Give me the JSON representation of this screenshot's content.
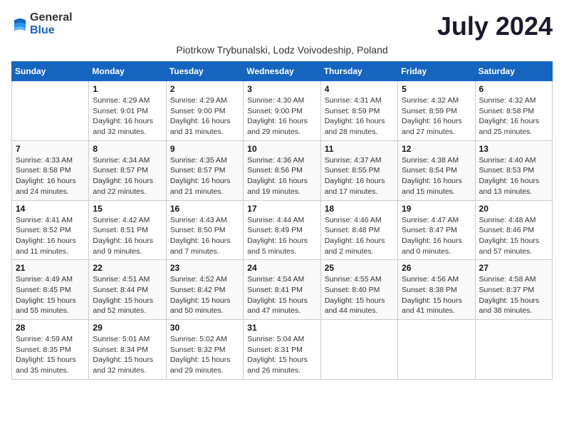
{
  "logo": {
    "general": "General",
    "blue": "Blue"
  },
  "title": "July 2024",
  "subtitle": "Piotrkow Trybunalski, Lodz Voivodeship, Poland",
  "days_of_week": [
    "Sunday",
    "Monday",
    "Tuesday",
    "Wednesday",
    "Thursday",
    "Friday",
    "Saturday"
  ],
  "weeks": [
    [
      {
        "day": "",
        "info": ""
      },
      {
        "day": "1",
        "info": "Sunrise: 4:29 AM\nSunset: 9:01 PM\nDaylight: 16 hours\nand 32 minutes."
      },
      {
        "day": "2",
        "info": "Sunrise: 4:29 AM\nSunset: 9:00 PM\nDaylight: 16 hours\nand 31 minutes."
      },
      {
        "day": "3",
        "info": "Sunrise: 4:30 AM\nSunset: 9:00 PM\nDaylight: 16 hours\nand 29 minutes."
      },
      {
        "day": "4",
        "info": "Sunrise: 4:31 AM\nSunset: 8:59 PM\nDaylight: 16 hours\nand 28 minutes."
      },
      {
        "day": "5",
        "info": "Sunrise: 4:32 AM\nSunset: 8:59 PM\nDaylight: 16 hours\nand 27 minutes."
      },
      {
        "day": "6",
        "info": "Sunrise: 4:32 AM\nSunset: 8:58 PM\nDaylight: 16 hours\nand 25 minutes."
      }
    ],
    [
      {
        "day": "7",
        "info": "Sunrise: 4:33 AM\nSunset: 8:58 PM\nDaylight: 16 hours\nand 24 minutes."
      },
      {
        "day": "8",
        "info": "Sunrise: 4:34 AM\nSunset: 8:57 PM\nDaylight: 16 hours\nand 22 minutes."
      },
      {
        "day": "9",
        "info": "Sunrise: 4:35 AM\nSunset: 8:57 PM\nDaylight: 16 hours\nand 21 minutes."
      },
      {
        "day": "10",
        "info": "Sunrise: 4:36 AM\nSunset: 8:56 PM\nDaylight: 16 hours\nand 19 minutes."
      },
      {
        "day": "11",
        "info": "Sunrise: 4:37 AM\nSunset: 8:55 PM\nDaylight: 16 hours\nand 17 minutes."
      },
      {
        "day": "12",
        "info": "Sunrise: 4:38 AM\nSunset: 8:54 PM\nDaylight: 16 hours\nand 15 minutes."
      },
      {
        "day": "13",
        "info": "Sunrise: 4:40 AM\nSunset: 8:53 PM\nDaylight: 16 hours\nand 13 minutes."
      }
    ],
    [
      {
        "day": "14",
        "info": "Sunrise: 4:41 AM\nSunset: 8:52 PM\nDaylight: 16 hours\nand 11 minutes."
      },
      {
        "day": "15",
        "info": "Sunrise: 4:42 AM\nSunset: 8:51 PM\nDaylight: 16 hours\nand 9 minutes."
      },
      {
        "day": "16",
        "info": "Sunrise: 4:43 AM\nSunset: 8:50 PM\nDaylight: 16 hours\nand 7 minutes."
      },
      {
        "day": "17",
        "info": "Sunrise: 4:44 AM\nSunset: 8:49 PM\nDaylight: 16 hours\nand 5 minutes."
      },
      {
        "day": "18",
        "info": "Sunrise: 4:46 AM\nSunset: 8:48 PM\nDaylight: 16 hours\nand 2 minutes."
      },
      {
        "day": "19",
        "info": "Sunrise: 4:47 AM\nSunset: 8:47 PM\nDaylight: 16 hours\nand 0 minutes."
      },
      {
        "day": "20",
        "info": "Sunrise: 4:48 AM\nSunset: 8:46 PM\nDaylight: 15 hours\nand 57 minutes."
      }
    ],
    [
      {
        "day": "21",
        "info": "Sunrise: 4:49 AM\nSunset: 8:45 PM\nDaylight: 15 hours\nand 55 minutes."
      },
      {
        "day": "22",
        "info": "Sunrise: 4:51 AM\nSunset: 8:44 PM\nDaylight: 15 hours\nand 52 minutes."
      },
      {
        "day": "23",
        "info": "Sunrise: 4:52 AM\nSunset: 8:42 PM\nDaylight: 15 hours\nand 50 minutes."
      },
      {
        "day": "24",
        "info": "Sunrise: 4:54 AM\nSunset: 8:41 PM\nDaylight: 15 hours\nand 47 minutes."
      },
      {
        "day": "25",
        "info": "Sunrise: 4:55 AM\nSunset: 8:40 PM\nDaylight: 15 hours\nand 44 minutes."
      },
      {
        "day": "26",
        "info": "Sunrise: 4:56 AM\nSunset: 8:38 PM\nDaylight: 15 hours\nand 41 minutes."
      },
      {
        "day": "27",
        "info": "Sunrise: 4:58 AM\nSunset: 8:37 PM\nDaylight: 15 hours\nand 38 minutes."
      }
    ],
    [
      {
        "day": "28",
        "info": "Sunrise: 4:59 AM\nSunset: 8:35 PM\nDaylight: 15 hours\nand 35 minutes."
      },
      {
        "day": "29",
        "info": "Sunrise: 5:01 AM\nSunset: 8:34 PM\nDaylight: 15 hours\nand 32 minutes."
      },
      {
        "day": "30",
        "info": "Sunrise: 5:02 AM\nSunset: 8:32 PM\nDaylight: 15 hours\nand 29 minutes."
      },
      {
        "day": "31",
        "info": "Sunrise: 5:04 AM\nSunset: 8:31 PM\nDaylight: 15 hours\nand 26 minutes."
      },
      {
        "day": "",
        "info": ""
      },
      {
        "day": "",
        "info": ""
      },
      {
        "day": "",
        "info": ""
      }
    ]
  ]
}
